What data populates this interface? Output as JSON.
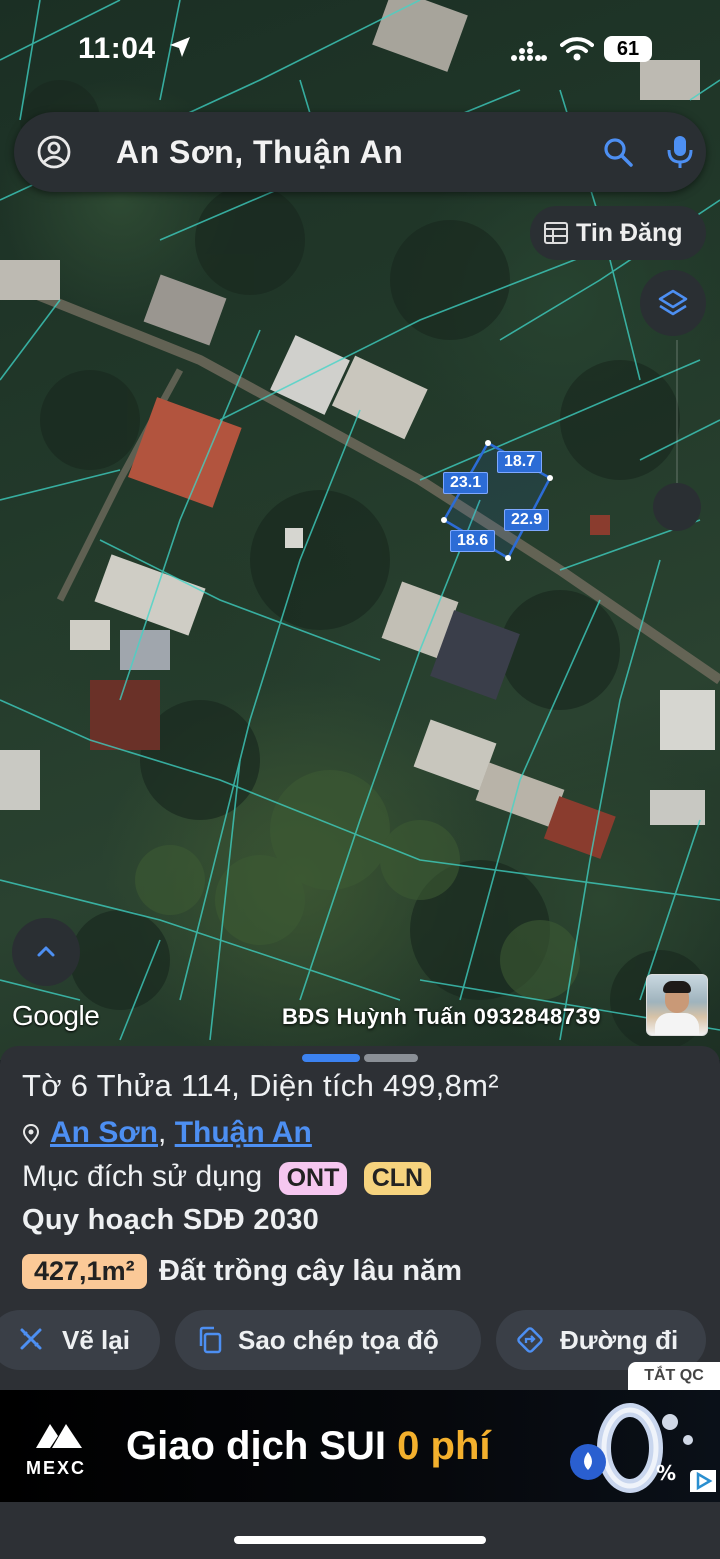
{
  "status_bar": {
    "time": "11:04",
    "battery": "61"
  },
  "search": {
    "query": "An Sơn, Thuận An"
  },
  "map": {
    "tin_dang_label": "Tin Đăng",
    "dimensions": {
      "top": "18.7",
      "left": "23.1",
      "right": "22.9",
      "bottom": "18.6"
    },
    "google_label": "Google",
    "watermark": "BĐS Huỳnh Tuấn 0932848739"
  },
  "parcel": {
    "title": "Tờ 6 Thửa 114, Diện tích 499,8m²",
    "commune": "An Sơn",
    "district": "Thuận An",
    "separator": ",",
    "purpose_label": "Mục đích sử dụng",
    "purpose_codes": [
      "ONT",
      "CLN"
    ],
    "plan_label": "Quy hoạch SDĐ 2030",
    "plan_area": "427,1m²",
    "plan_type": "Đất trồng cây lâu năm"
  },
  "actions": {
    "redraw": "Vẽ lại",
    "copy_coords": "Sao chép tọa độ",
    "directions": "Đường đi"
  },
  "ad": {
    "close_label": "TẮT QC",
    "brand": "MEXC",
    "headline_prefix": "Giao dịch SUI ",
    "headline_highlight": "0 phí"
  },
  "colors": {
    "accent": "#4d8ff2",
    "parcel_outline": "#2c6cd6",
    "ont_badge": "#f6c7f0",
    "cln_badge": "#f6d37e",
    "area_badge": "#fbc997"
  }
}
